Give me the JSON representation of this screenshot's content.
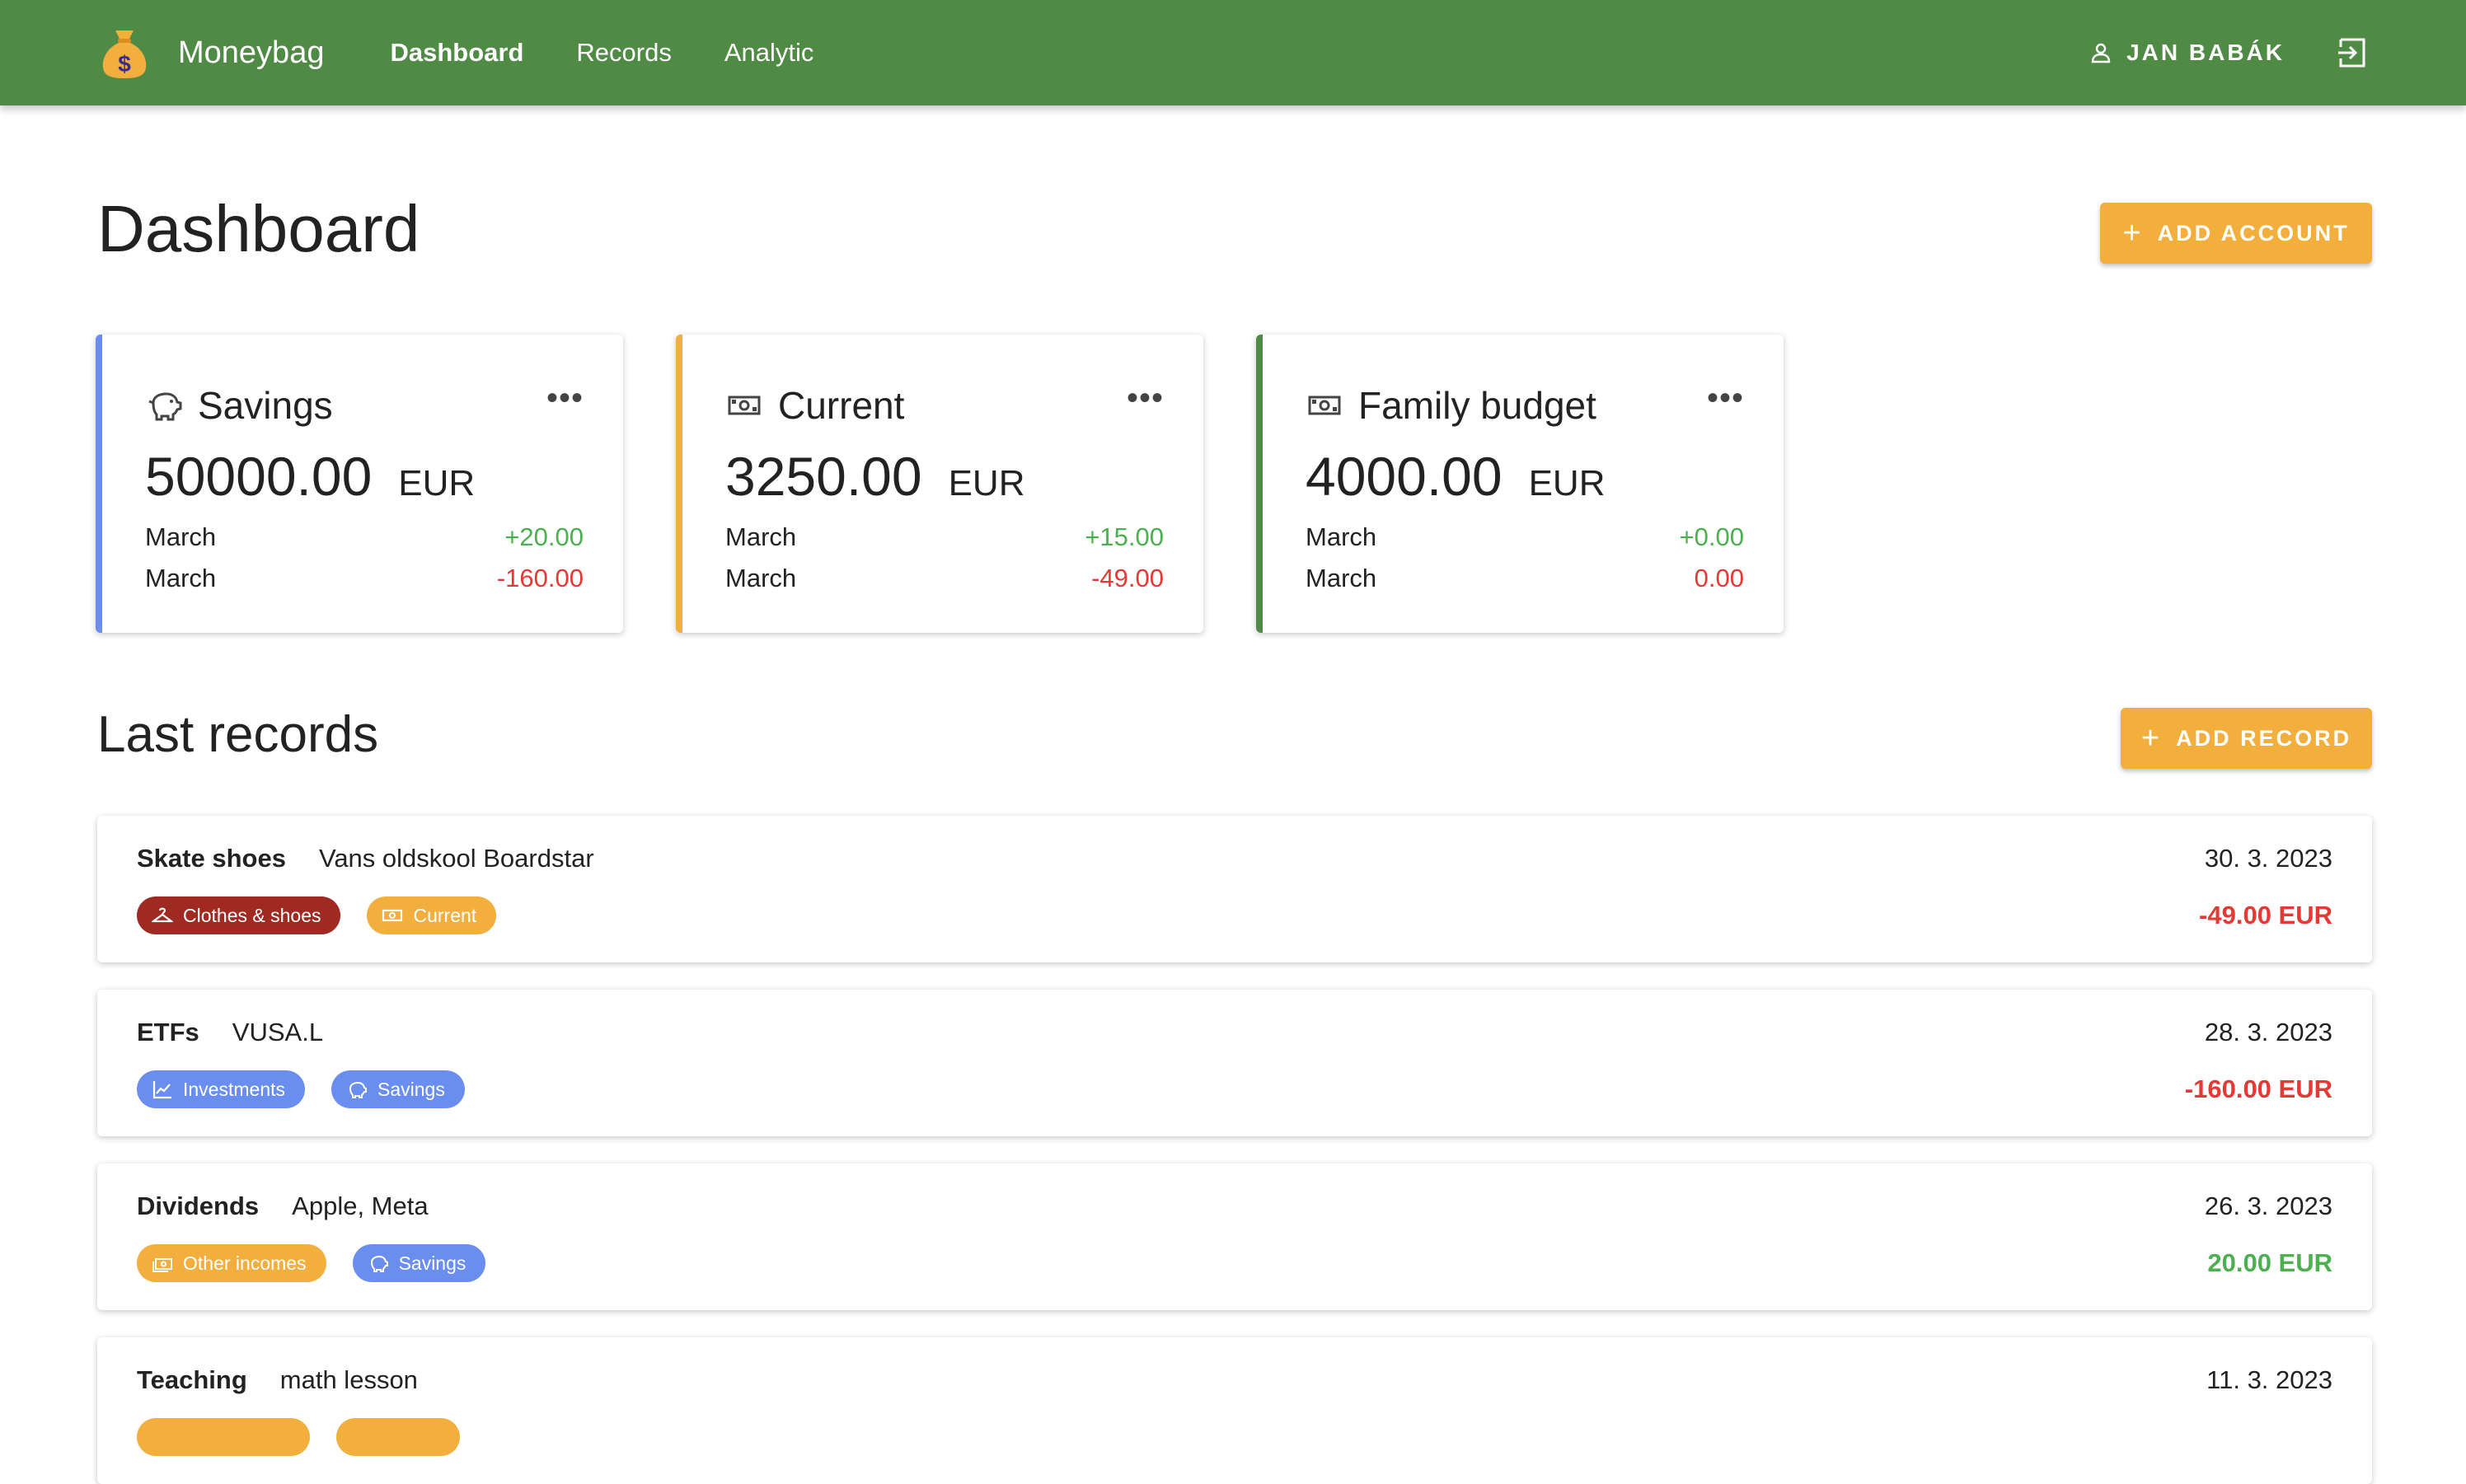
{
  "app": {
    "brand": "Moneybag",
    "nav": [
      {
        "label": "Dashboard"
      },
      {
        "label": "Records"
      },
      {
        "label": "Analytic"
      }
    ],
    "user_name": "JAN BABÁK",
    "colors": {
      "appbar": "#508b45",
      "accent": "#f3af3d",
      "positive": "#4caf50",
      "negative": "#e53935"
    }
  },
  "dashboard": {
    "title": "Dashboard",
    "add_account_label": "ADD ACCOUNT",
    "accounts": [
      {
        "name": "Savings",
        "icon": "piggy-bank-icon",
        "color": "#6a8ef0",
        "balance": "50000.00",
        "currency": "EUR",
        "income_label": "March",
        "income": "+20.00",
        "expense_label": "March",
        "expense": "-160.00"
      },
      {
        "name": "Current",
        "icon": "banknote-icon",
        "color": "#f3af3d",
        "balance": "3250.00",
        "currency": "EUR",
        "income_label": "March",
        "income": "+15.00",
        "expense_label": "March",
        "expense": "-49.00"
      },
      {
        "name": "Family budget",
        "icon": "banknote-icon",
        "color": "#508b45",
        "balance": "4000.00",
        "currency": "EUR",
        "income_label": "March",
        "income": "+0.00",
        "expense_label": "March",
        "expense": "0.00"
      }
    ],
    "more_label": "•••"
  },
  "records": {
    "title": "Last records",
    "add_record_label": "ADD RECORD",
    "items": [
      {
        "title": "Skate shoes",
        "description": "Vans oldskool Boardstar",
        "date": "30. 3. 2023",
        "amount": "-49.00 EUR",
        "amount_type": "negative",
        "category": {
          "label": "Clothes & shoes",
          "icon": "hanger-icon",
          "color": "#9e2a22"
        },
        "account": {
          "label": "Current",
          "icon": "banknote-icon",
          "color": "#f3af3d"
        }
      },
      {
        "title": "ETFs",
        "description": "VUSA.L",
        "date": "28. 3. 2023",
        "amount": "-160.00 EUR",
        "amount_type": "negative",
        "category": {
          "label": "Investments",
          "icon": "chart-line-icon",
          "color": "#6a8ef0"
        },
        "account": {
          "label": "Savings",
          "icon": "piggy-bank-icon",
          "color": "#6a8ef0"
        }
      },
      {
        "title": "Dividends",
        "description": "Apple, Meta",
        "date": "26. 3. 2023",
        "amount": "20.00 EUR",
        "amount_type": "positive",
        "category": {
          "label": "Other incomes",
          "icon": "cash-icon",
          "color": "#f3af3d"
        },
        "account": {
          "label": "Savings",
          "icon": "piggy-bank-icon",
          "color": "#6a8ef0"
        }
      },
      {
        "title": "Teaching",
        "description": "math lesson",
        "date": "11. 3. 2023",
        "amount": "",
        "amount_type": "positive",
        "category": {
          "label": "",
          "icon": "cash-icon",
          "color": "#f3af3d"
        },
        "account": {
          "label": "",
          "icon": "banknote-icon",
          "color": "#f3af3d"
        }
      }
    ]
  }
}
